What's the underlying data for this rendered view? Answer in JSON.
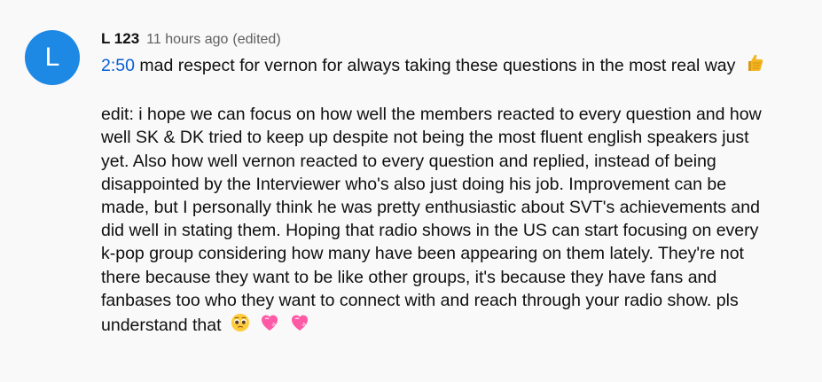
{
  "comment": {
    "avatar_letter": "L",
    "author": "L 123",
    "time": "11 hours ago",
    "edited": "(edited)",
    "timestamp_link": "2:50",
    "first_line_text": "mad respect for vernon for always taking these questions in the most real way",
    "first_line_emoji": "thumbs-up-icon",
    "edit_lines": [
      "edit: i hope we can focus on how well the members reacted to every question and how",
      "well SK & DK tried to keep up despite not being the most fluent english speakers just",
      "yet. Also how well vernon reacted to every question and replied, instead of being",
      "disappointed by the Interviewer who's also just doing his job. Improvement can be",
      "made, but I personally think he was pretty enthusiastic about SVT's achievements and",
      "did well in stating them. Hoping that radio shows in the US can start focusing on every",
      "k-pop group considering how many have been appearing on them lately. They're not",
      "there because they want to be like other groups, it's because they have fans and",
      "fanbases too who they want to connect with and reach through your radio show. pls"
    ],
    "last_line_text": "understand that",
    "last_line_emojis": [
      "pleading-face-icon",
      "pink-heart-icon",
      "pink-heart-icon"
    ],
    "avatar_color": "#1e88e5",
    "link_color": "#065fd4"
  }
}
